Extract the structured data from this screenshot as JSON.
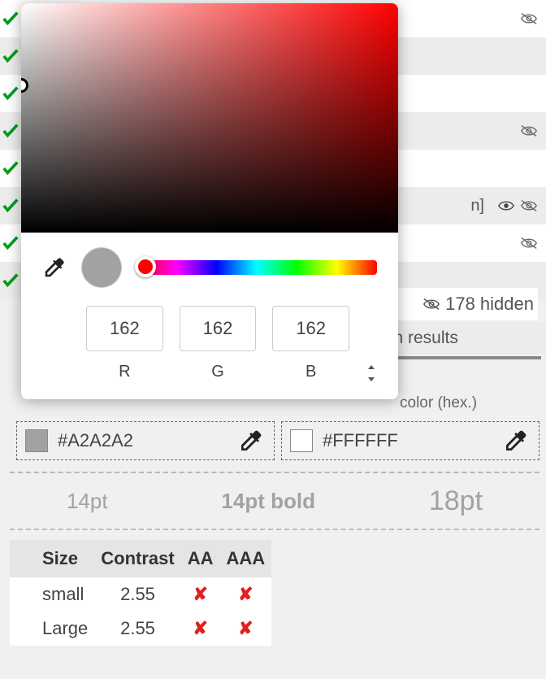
{
  "background_rows": {
    "count": 8,
    "partial_text": "n]"
  },
  "hidden": {
    "label": "178 hidden"
  },
  "results_fragment": "sh results",
  "hex_label_fragment": "color (hex.)",
  "picker": {
    "swatch_hex": "#A2A2A2",
    "channels": {
      "r": "162",
      "g": "162",
      "b": "162",
      "r_label": "R",
      "g_label": "G",
      "b_label": "B"
    }
  },
  "swatches": {
    "fg_hex": "#A2A2A2",
    "bg_hex": "#FFFFFF"
  },
  "pt_preview": {
    "p14": "14pt",
    "p14b": "14pt bold",
    "p18": "18pt"
  },
  "table": {
    "headers": {
      "size": "Size",
      "contrast": "Contrast",
      "aa": "AA",
      "aaa": "AAA"
    },
    "rows": [
      {
        "size": "small",
        "contrast": "2.55",
        "aa": "✘",
        "aaa": "✘"
      },
      {
        "size": "Large",
        "contrast": "2.55",
        "aa": "✘",
        "aaa": "✘"
      }
    ]
  }
}
